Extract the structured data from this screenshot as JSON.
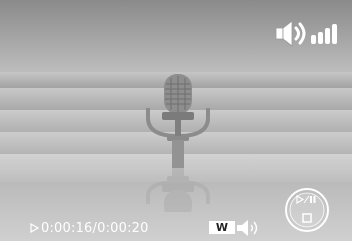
{
  "recording": {
    "elapsed": "0:00:16",
    "separator": " / ",
    "total": "0:00:20"
  },
  "volume_control": {
    "zoom_w_label": "W"
  },
  "icons": {
    "volume": "speaker-volume-icon",
    "microphone": "microphone-icon",
    "play": "play-indicator-icon",
    "zoom_speaker": "speaker-icon",
    "nav": "play-pause-stop-control-icon"
  },
  "colors": {
    "overlay_text": "#ffffff",
    "background_dark": "#8a8a8a",
    "background_light": "#d2d2d2"
  }
}
